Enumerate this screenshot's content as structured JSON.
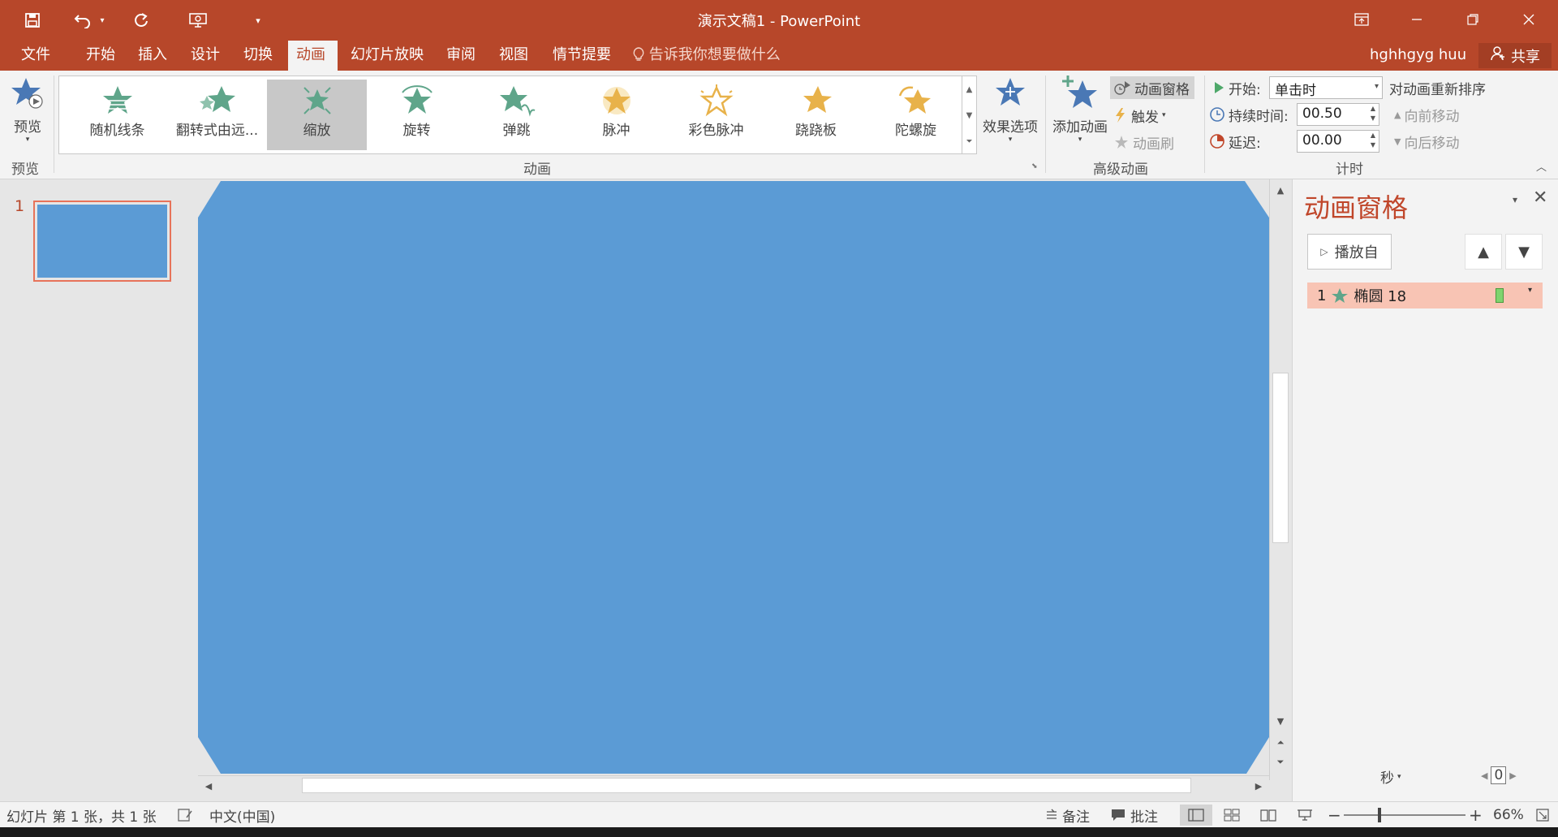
{
  "app": {
    "title": "演示文稿1 - PowerPoint"
  },
  "tabs": [
    {
      "label": "文件"
    },
    {
      "label": "开始"
    },
    {
      "label": "插入"
    },
    {
      "label": "设计"
    },
    {
      "label": "切换"
    },
    {
      "label": "动画"
    },
    {
      "label": "幻灯片放映"
    },
    {
      "label": "审阅"
    },
    {
      "label": "视图"
    },
    {
      "label": "情节提要"
    }
  ],
  "tell_me": "告诉我你想要做什么",
  "user": "hghhgyg huu",
  "share": "共享",
  "ribbon": {
    "preview": {
      "label": "预览",
      "group": "预览"
    },
    "animations_group": "动画",
    "gallery": [
      {
        "label": "随机线条"
      },
      {
        "label": "翻转式由远..."
      },
      {
        "label": "缩放"
      },
      {
        "label": "旋转"
      },
      {
        "label": "弹跳"
      },
      {
        "label": "脉冲"
      },
      {
        "label": "彩色脉冲"
      },
      {
        "label": "跷跷板"
      },
      {
        "label": "陀螺旋"
      }
    ],
    "effect_options": "效果选项",
    "add_animation": "添加动画",
    "animation_pane": "动画窗格",
    "trigger": "触发",
    "animation_painter": "动画刷",
    "advanced_group": "高级动画",
    "start_label": "开始:",
    "start_value": "单击时",
    "duration_label": "持续时间:",
    "duration_value": "00.50",
    "delay_label": "延迟:",
    "delay_value": "00.00",
    "reorder": "对动画重新排序",
    "move_earlier": "向前移动",
    "move_later": "向后移动",
    "timing_group": "计时",
    "colors": {
      "green_star": "#5fa58a",
      "gold_star": "#e8b24a"
    }
  },
  "thumbnails": {
    "slide_number": "1"
  },
  "anim_pane": {
    "title": "动画窗格",
    "play_from": "播放自",
    "item_number": "1",
    "item_name": "椭圆 18",
    "seconds": "秒",
    "zoom_value": "0"
  },
  "status": {
    "slide_info": "幻灯片 第 1 张，共 1 张",
    "language": "中文(中国)",
    "notes": "备注",
    "comments": "批注",
    "zoom": "66%"
  },
  "colors": {
    "accent": "#b7472a",
    "slide_fill": "#5b9bd5",
    "anim_item_bg": "#f8c4b4"
  }
}
